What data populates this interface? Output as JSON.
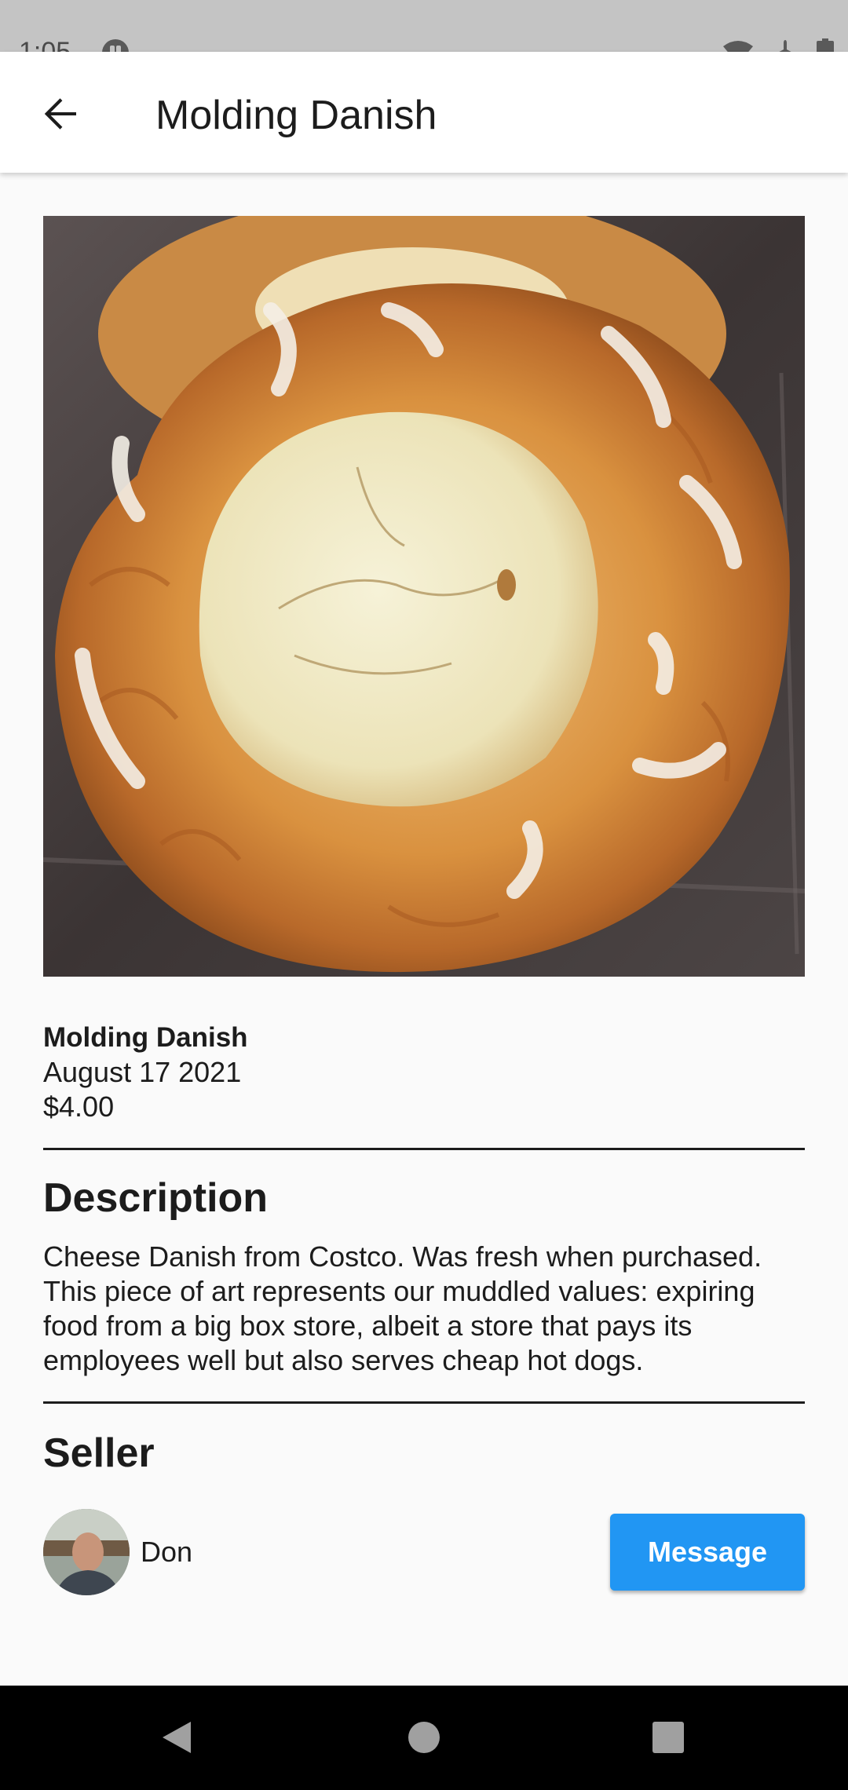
{
  "status_bar": {
    "time": "1:05",
    "icons": [
      "app-notification-icon",
      "wifi-icon",
      "airplane-mode-icon",
      "battery-icon"
    ]
  },
  "app_bar": {
    "back_icon": "arrow-back-icon",
    "title": "Molding Danish"
  },
  "item": {
    "image": "cheese-danish-photo",
    "name": "Molding Danish",
    "date": "August 17 2021",
    "price": "$4.00"
  },
  "description": {
    "heading": "Description",
    "text": "Cheese Danish from Costco. Was fresh when purchased. This piece of art represents our muddled values: expiring food from a big box store, albeit a store that pays its employees well but also serves cheap hot dogs."
  },
  "seller": {
    "heading": "Seller",
    "name": "Don",
    "message_label": "Message"
  },
  "colors": {
    "accent": "#2196f3",
    "status_bar": "#c4c4c4",
    "nav_bar": "#000000",
    "background": "#fafafa"
  },
  "nav_bar": {
    "icons": [
      "nav-back-icon",
      "nav-home-icon",
      "nav-recents-icon"
    ]
  }
}
